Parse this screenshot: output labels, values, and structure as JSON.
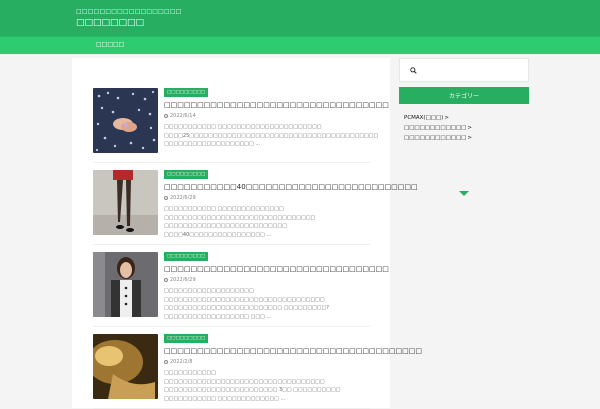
{
  "header": {
    "tagline": "□□□□□□□□□□□□□□□□□□",
    "site_title": "□□□□□□□□",
    "bg_color": "#27ae60"
  },
  "nav": {
    "items": [
      {
        "label": "□□□□□"
      }
    ]
  },
  "articles": [
    {
      "category": "□□□□□□□□□",
      "title": "□□□□□□□□□□□□□□□□□□□□□□□□□□□□□□□□□□",
      "date": "2022/6/14",
      "excerpt": "□□□□□□□□□□□ □□□□□□□□□□□□□□□□□□□□□□ □□□□25□□□□□□□□□□□□□□□□□□□□□□□□□□□□□□□□□□□□□□□□ □□□□□□□□□□□□□□□□□□□ ..."
    },
    {
      "category": "□□□□□□□□□",
      "title": "□□□□□□□□□□□40□□□□□□□□□□□□□□□□□□□□□□□□□□",
      "date": "2022/6/29",
      "excerpt": "□□□□□□□□□□□ □□□□□□□□□□□□□□ □□□□□□□□□□□□□□□□□□□□□□□□□□□□□□□□ □□□□□□□□□□□□□□□□□□□□□□□□□□ □□□□40□□□□□□□□□□□□□□□□ ..."
    },
    {
      "category": "□□□□□□□□□",
      "title": "□□□□□□□□□□□□□□□□□□□□□□□□□□□□□□□□□□",
      "date": "2022/6/29",
      "excerpt": "□□□□□□□□□□□□□□□□□□□ □□□□□□□□□□□□□□□□□□□□□□□□□□□□□□□□□□ □□□□□□□□□□□□□□□□□□□□□□□□□ □□□□□□□□□? □□□□□□□□□□□□□□□□□□ □□□ ..."
    },
    {
      "category": "□□□□□□□□□",
      "title": "□□□□□□□□□□□□□□□□□□□□□□□□□□□□□□□□□□□□□□□",
      "date": "2022/2/8",
      "excerpt": "□□□□□□□□□□□ □□□□□□□□□□□□□□□□□□□□□□□□□□□□□□□□□□ □□□□□□□□□□□□□□□□□□□□□□□□ 3□□ □□□□□□□□□□ □□□□□□□□□□□ □□□□□□□□□□□□□ ..."
    }
  ],
  "sidebar": {
    "search_icon": "search-icon",
    "category_heading": "カテゴリー",
    "categories": [
      {
        "label": "PCMAX(□□□)"
      },
      {
        "label": "□□□□□□□□□□□□"
      },
      {
        "label": "□□□□□□□□□□□□"
      }
    ]
  },
  "colors": {
    "accent": "#27ae60",
    "nav": "#2ecc71",
    "background": "#f4f4f4"
  }
}
